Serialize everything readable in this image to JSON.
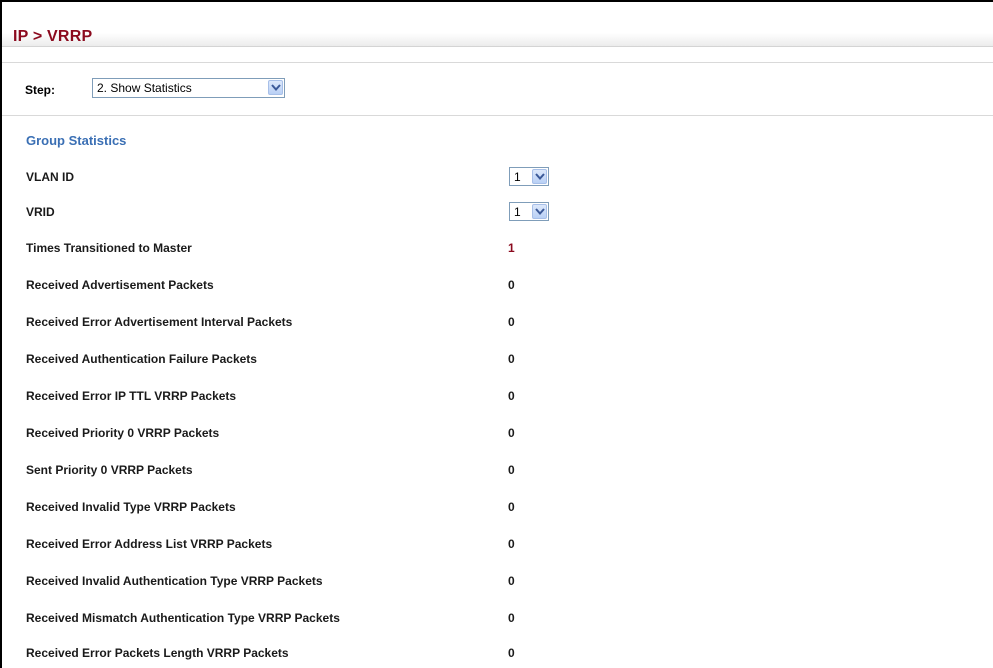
{
  "header": {
    "title": "IP > VRRP"
  },
  "step": {
    "label": "Step:",
    "selected": "2. Show Statistics"
  },
  "section": {
    "title": "Group Statistics"
  },
  "fields": {
    "vlan_id": {
      "label": "VLAN ID",
      "value": "1"
    },
    "vrid": {
      "label": "VRID",
      "value": "1"
    }
  },
  "stats": [
    {
      "label": "Times Transitioned to Master",
      "value": "1"
    },
    {
      "label": "Received Advertisement Packets",
      "value": "0"
    },
    {
      "label": "Received Error Advertisement Interval Packets",
      "value": "0"
    },
    {
      "label": "Received Authentication Failure Packets",
      "value": "0"
    },
    {
      "label": "Received Error IP TTL VRRP Packets",
      "value": "0"
    },
    {
      "label": "Received Priority 0 VRRP Packets",
      "value": "0"
    },
    {
      "label": "Sent Priority 0 VRRP Packets",
      "value": "0"
    },
    {
      "label": "Received Invalid Type VRRP Packets",
      "value": "0"
    },
    {
      "label": "Received Error Address List VRRP Packets",
      "value": "0"
    },
    {
      "label": "Received Invalid Authentication Type VRRP Packets",
      "value": "0"
    },
    {
      "label": "Received Mismatch Authentication Type VRRP Packets",
      "value": "0"
    },
    {
      "label": "Received Error Packets Length VRRP Packets",
      "value": "0"
    }
  ],
  "colors": {
    "title": "#8b0a1e",
    "section": "#3a6fb4",
    "select_border": "#7f9db9"
  },
  "icons": {
    "dropdown": "chevron-down-icon"
  }
}
